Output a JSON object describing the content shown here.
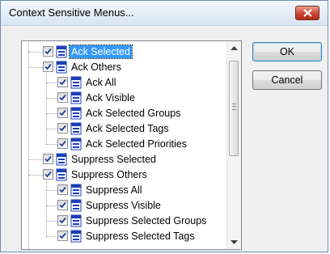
{
  "window": {
    "title": "Context Sensitive Menus..."
  },
  "buttons": {
    "ok_label": "OK",
    "cancel_label": "Cancel"
  },
  "tree": {
    "items": [
      {
        "label": "Ack Selected",
        "level": 1,
        "checked": true,
        "selected": true
      },
      {
        "label": "Ack Others",
        "level": 1,
        "checked": true,
        "selected": false
      },
      {
        "label": "Ack All",
        "level": 2,
        "checked": true,
        "selected": false
      },
      {
        "label": "Ack Visible",
        "level": 2,
        "checked": true,
        "selected": false
      },
      {
        "label": "Ack Selected Groups",
        "level": 2,
        "checked": true,
        "selected": false
      },
      {
        "label": "Ack Selected Tags",
        "level": 2,
        "checked": true,
        "selected": false
      },
      {
        "label": "Ack Selected Priorities",
        "level": 2,
        "checked": true,
        "selected": false
      },
      {
        "label": "Suppress Selected",
        "level": 1,
        "checked": true,
        "selected": false
      },
      {
        "label": "Suppress Others",
        "level": 1,
        "checked": true,
        "selected": false
      },
      {
        "label": "Suppress All",
        "level": 2,
        "checked": true,
        "selected": false
      },
      {
        "label": "Suppress Visible",
        "level": 2,
        "checked": true,
        "selected": false
      },
      {
        "label": "Suppress Selected Groups",
        "level": 2,
        "checked": true,
        "selected": false
      },
      {
        "label": "Suppress Selected Tags",
        "level": 2,
        "checked": true,
        "selected": false
      }
    ]
  },
  "icons": {
    "close": "close-x-icon",
    "checkbox": "checkmark-icon",
    "node": "menu-node-icon",
    "scroll_up": "up-arrow-icon",
    "scroll_down": "down-arrow-icon"
  },
  "colors": {
    "selection": "#3399ff",
    "close_button": "#c8452f",
    "node_icon": "#1c3fb8"
  }
}
